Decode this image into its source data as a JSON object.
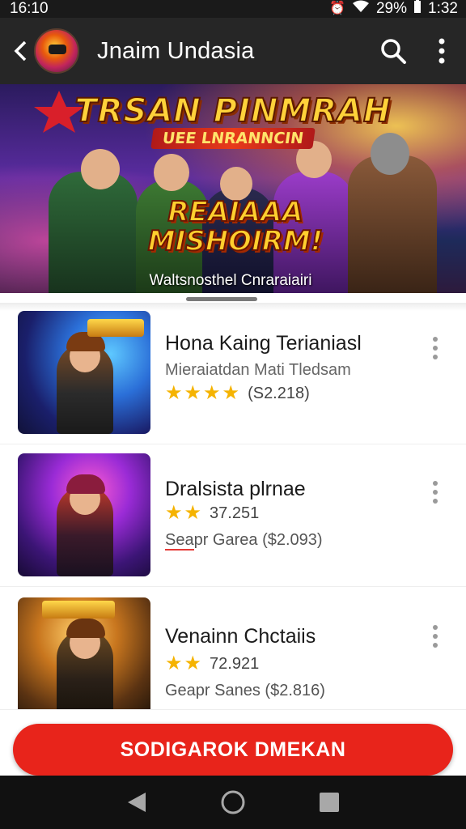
{
  "status_bar": {
    "time": "16:10",
    "battery": "29%",
    "clock_right": "1:32",
    "icons": [
      "alarm-icon",
      "wifi-icon",
      "battery-icon"
    ]
  },
  "app_bar": {
    "title": "Jnaim Undasia",
    "icons": [
      "back-arrow-icon",
      "search-icon",
      "more-vert-icon"
    ]
  },
  "banner": {
    "title": "TRSAN PINMRAH",
    "ribbon": "UEE LNRANNCIN",
    "logo_line1": "REAIAAA",
    "logo_line2": "MISHOIRM!",
    "subtitle": "Waltsnosthel Cnraraiairi"
  },
  "games": [
    {
      "title": "Hona Kaing Terianiasl",
      "subtitle": "Mieraiatdan Mati Tledsam",
      "stars": 4,
      "rating_text": "(S2.218)"
    },
    {
      "title": "Dralsista plrnae",
      "stars": 2,
      "rating_text": "37.251",
      "price_text": "Seapr Garea ($2.093)"
    },
    {
      "title": "Venainn Chctaiis",
      "stars": 2,
      "rating_text": "72.921",
      "price_text": "Geapr Sanes ($2.816)"
    }
  ],
  "cta": {
    "label": "SODIGAROK DMEKAN"
  },
  "nav_bar": {
    "icons": [
      "back-triangle-icon",
      "home-circle-icon",
      "recents-square-icon"
    ]
  },
  "colors": {
    "accent": "#e8241b",
    "star": "#f5b301",
    "appbar": "#262626"
  }
}
